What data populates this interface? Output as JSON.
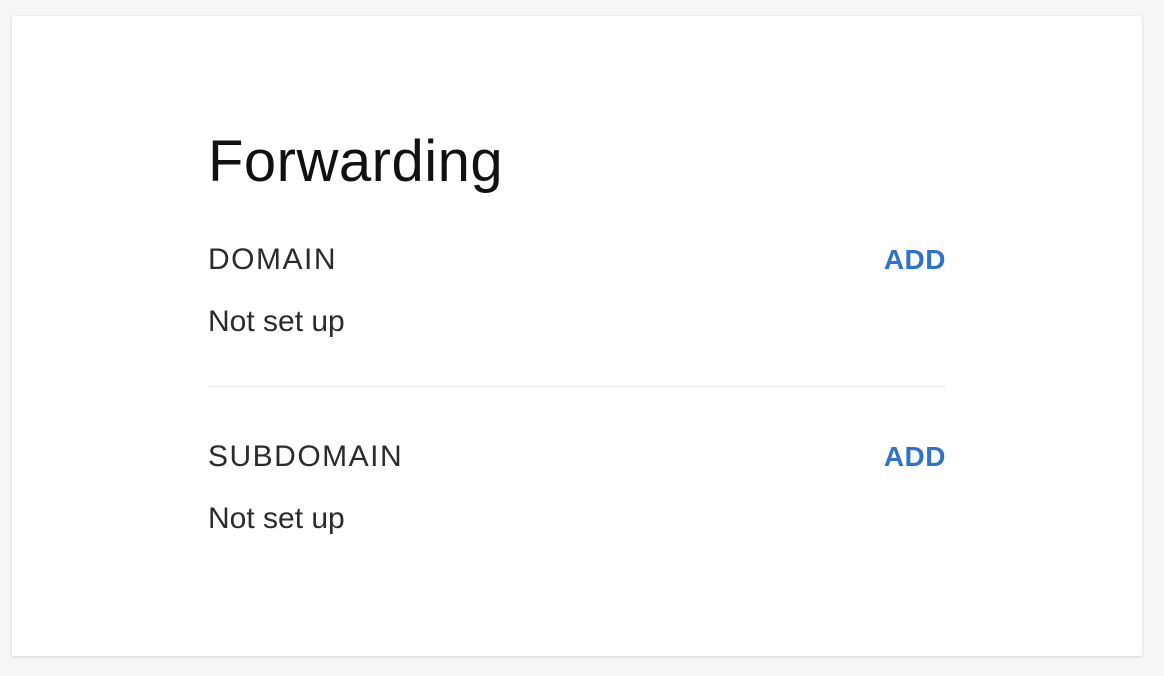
{
  "card": {
    "title": "Forwarding",
    "sections": [
      {
        "label": "DOMAIN",
        "action_label": "ADD",
        "status": "Not set up"
      },
      {
        "label": "SUBDOMAIN",
        "action_label": "ADD",
        "status": "Not set up"
      }
    ]
  },
  "colors": {
    "accent": "#2f72c9",
    "text": "#2b2b2b",
    "title": "#111111",
    "background": "#f5f6f8",
    "card": "#ffffff",
    "divider": "#ececec"
  }
}
